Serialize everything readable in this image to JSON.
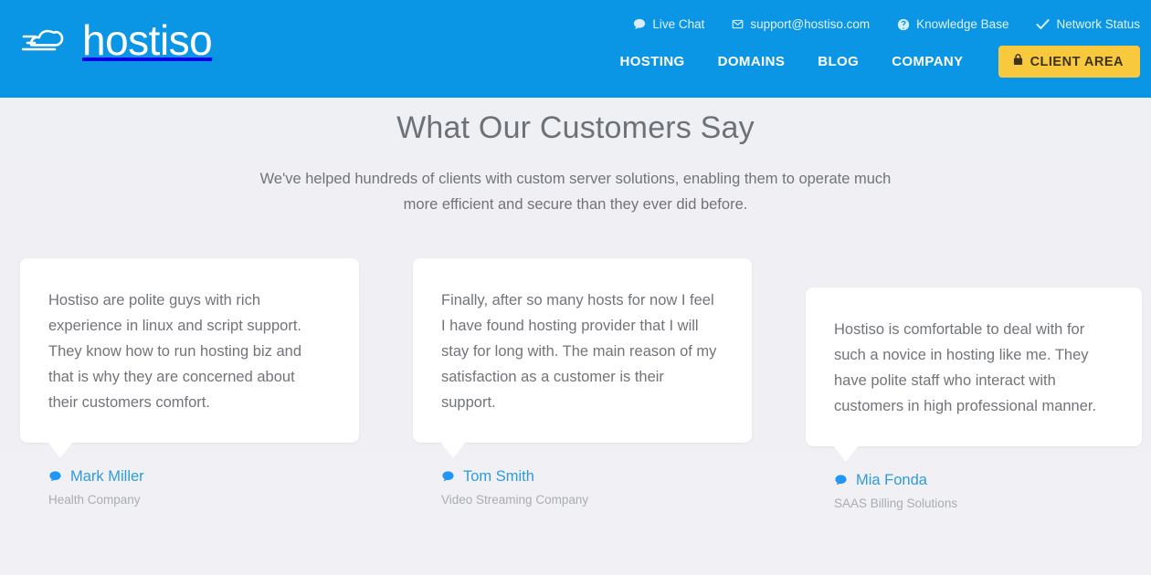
{
  "header": {
    "logo_text": "hostiso",
    "logo_icon": "cloud-speed-icon",
    "toplinks": [
      {
        "label": "Live Chat",
        "icon": "chat-bubble-icon"
      },
      {
        "label": "support@hostiso.com",
        "icon": "envelope-icon"
      },
      {
        "label": "Knowledge Base",
        "icon": "question-circle-icon"
      },
      {
        "label": "Network Status",
        "icon": "check-icon"
      }
    ],
    "nav": [
      {
        "label": "HOSTING"
      },
      {
        "label": "DOMAINS"
      },
      {
        "label": "BLOG"
      },
      {
        "label": "COMPANY"
      }
    ],
    "client_area": {
      "label": "CLIENT AREA",
      "icon": "lock-icon"
    },
    "colors": {
      "bar": "#0b96e5",
      "button": "#f8c93d",
      "button_text": "#3d3319"
    }
  },
  "section": {
    "title": "What Our Customers Say",
    "subtitle": "We've helped hundreds of clients with custom server solutions, enabling them to operate much more efficient and secure than they ever did before."
  },
  "testimonials": [
    {
      "quote": "Hostiso are polite guys with rich experience in linux and script support. They know how to run hosting biz and that is why they are concerned about their customers comfort.",
      "name": "Mark Miller",
      "role": "Health Company",
      "icon": "chat-bubble-icon"
    },
    {
      "quote": "Finally, after so many hosts for now I feel I have found hosting provider that I will stay for long with. The main reason of my satisfaction as a customer is their support.",
      "name": "Tom Smith",
      "role": "Video Streaming Company",
      "icon": "chat-bubble-icon"
    },
    {
      "quote": "Hostiso is comfortable to deal with for such a novice in hosting like me. They have polite staff who interact with customers in high professional manner.",
      "name": "Mia Fonda",
      "role": "SAAS Billing Solutions",
      "icon": "chat-bubble-icon"
    }
  ],
  "colors": {
    "accent": "#2d9cdb",
    "body_bg": "#f0f0f4",
    "text": "#717479",
    "muted": "#a9adb4"
  }
}
